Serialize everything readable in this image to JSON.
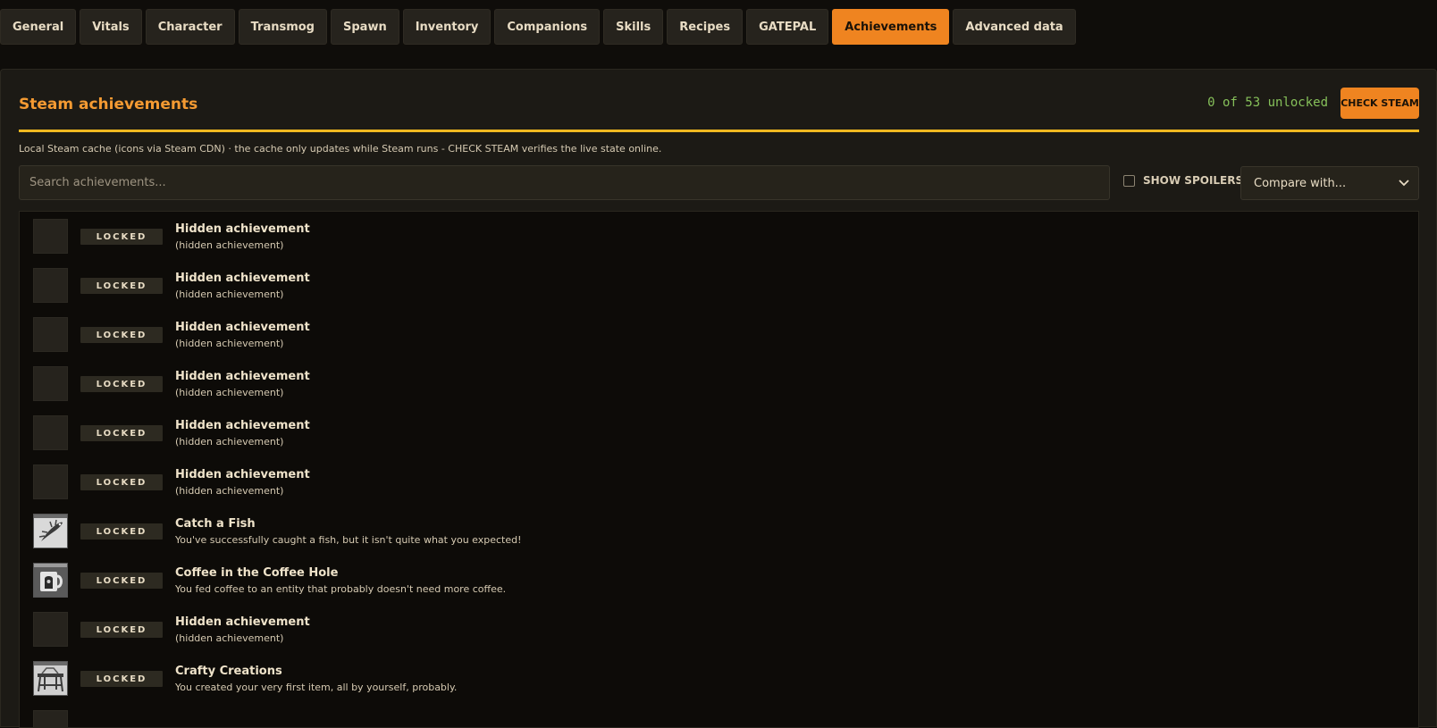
{
  "tabs": [
    {
      "label": "General",
      "active": false
    },
    {
      "label": "Vitals",
      "active": false
    },
    {
      "label": "Character",
      "active": false
    },
    {
      "label": "Transmog",
      "active": false
    },
    {
      "label": "Spawn",
      "active": false
    },
    {
      "label": "Inventory",
      "active": false
    },
    {
      "label": "Companions",
      "active": false
    },
    {
      "label": "Skills",
      "active": false
    },
    {
      "label": "Recipes",
      "active": false
    },
    {
      "label": "GATEPAL",
      "active": false
    },
    {
      "label": "Achievements",
      "active": true
    },
    {
      "label": "Advanced data",
      "active": false
    }
  ],
  "panel": {
    "title": "Steam achievements",
    "unlock_count": "0 of 53 unlocked",
    "check_label": "CHECK STEAM",
    "note": "Local Steam cache (icons via Steam CDN) · the cache only updates while Steam runs - CHECK STEAM verifies the live state online."
  },
  "controls": {
    "search_placeholder": "Search achievements...",
    "search_value": "",
    "spoilers_label": "SHOW SPOILERS",
    "spoilers_checked": false,
    "compare_selected": "Compare with..."
  },
  "colors": {
    "accent": "#ef8420",
    "title": "#f49a32",
    "divider": "#f0b820",
    "count": "#86c05a"
  },
  "achievements": [
    {
      "status": "LOCKED",
      "name": "Hidden achievement",
      "desc": "(hidden achievement)",
      "icon": "empty"
    },
    {
      "status": "LOCKED",
      "name": "Hidden achievement",
      "desc": "(hidden achievement)",
      "icon": "empty"
    },
    {
      "status": "LOCKED",
      "name": "Hidden achievement",
      "desc": "(hidden achievement)",
      "icon": "empty"
    },
    {
      "status": "LOCKED",
      "name": "Hidden achievement",
      "desc": "(hidden achievement)",
      "icon": "empty"
    },
    {
      "status": "LOCKED",
      "name": "Hidden achievement",
      "desc": "(hidden achievement)",
      "icon": "empty"
    },
    {
      "status": "LOCKED",
      "name": "Hidden achievement",
      "desc": "(hidden achievement)",
      "icon": "empty"
    },
    {
      "status": "LOCKED",
      "name": "Catch a Fish",
      "desc": "You've successfully caught a fish, but it isn't quite what you expected!",
      "icon": "fish-icon"
    },
    {
      "status": "LOCKED",
      "name": "Coffee in the Coffee Hole",
      "desc": "You fed coffee to an entity that probably doesn't need more coffee.",
      "icon": "coffee-mug-icon"
    },
    {
      "status": "LOCKED",
      "name": "Hidden achievement",
      "desc": "(hidden achievement)",
      "icon": "empty"
    },
    {
      "status": "LOCKED",
      "name": "Crafty Creations",
      "desc": "You created your very first item, all by yourself, probably.",
      "icon": "workbench-icon"
    },
    {
      "status": "",
      "name": "",
      "desc": "",
      "icon": "empty"
    }
  ]
}
